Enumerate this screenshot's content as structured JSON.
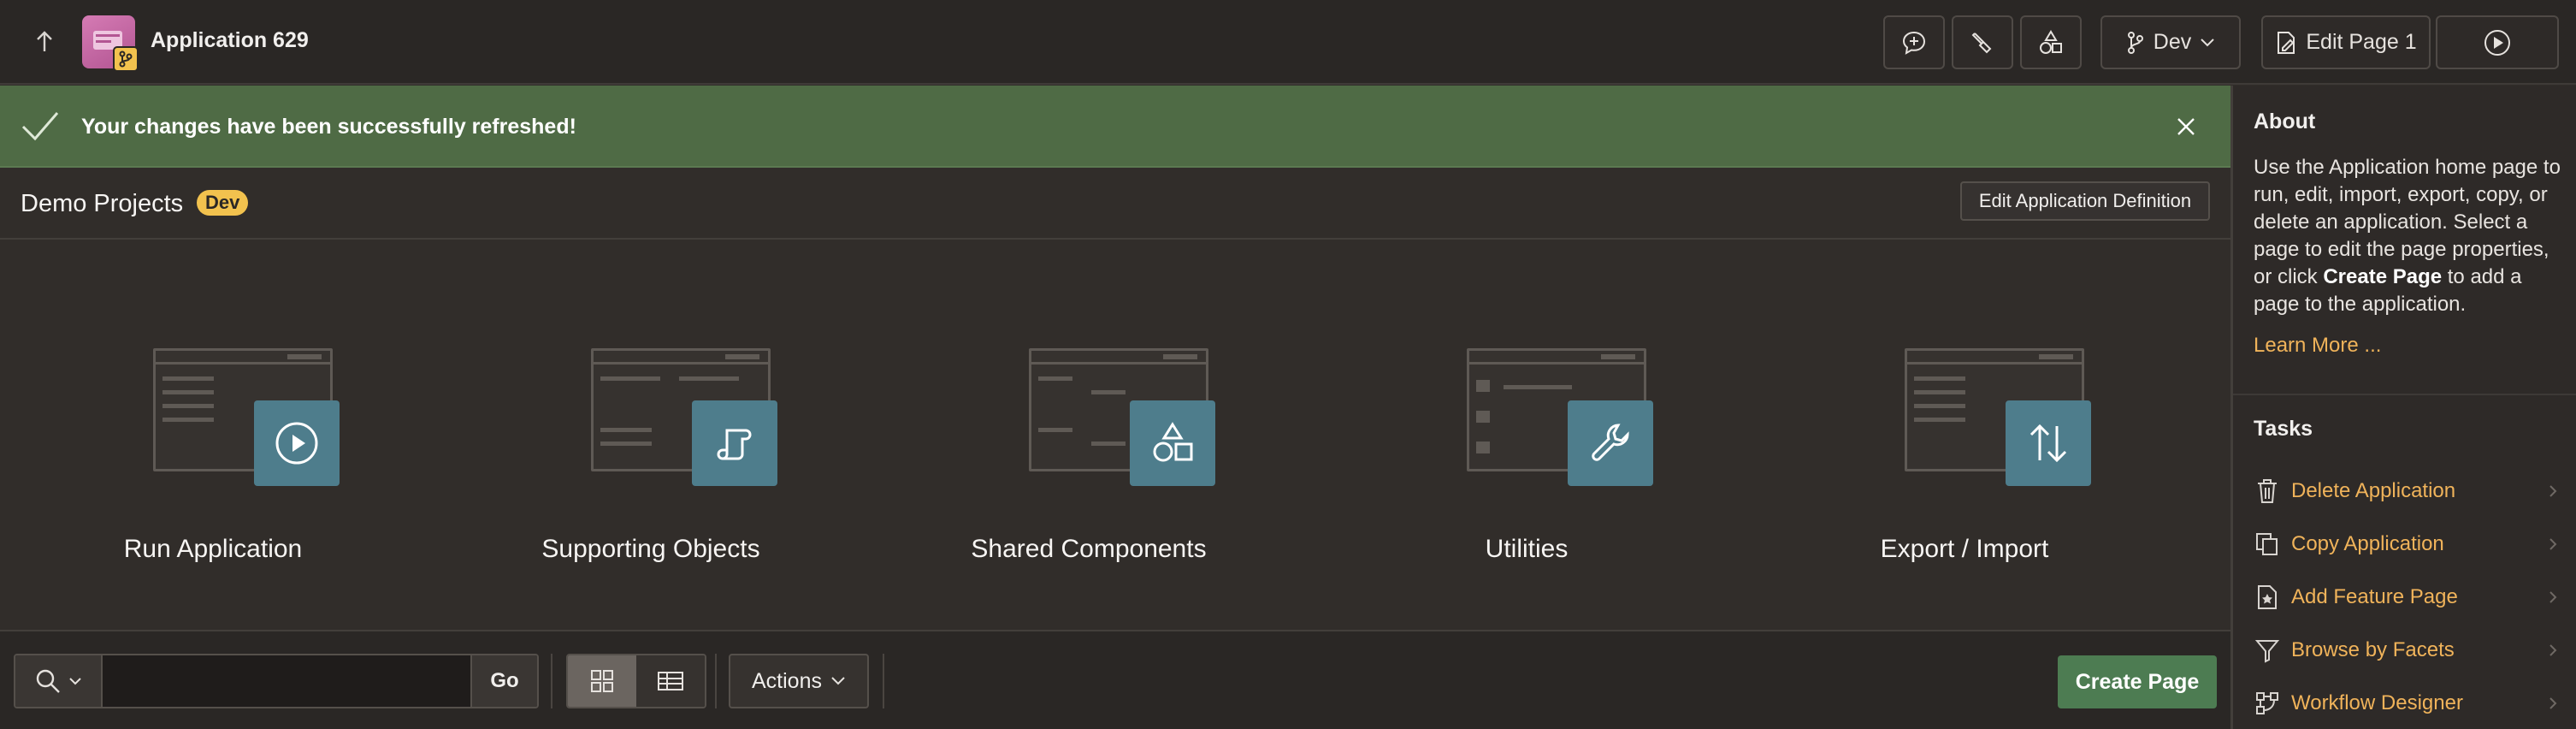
{
  "header": {
    "app_title": "Application 629",
    "branch_label": "Dev",
    "edit_page_label": "Edit Page 1"
  },
  "banner": {
    "message": "Your changes have been successfully refreshed!"
  },
  "region": {
    "title": "Demo Projects",
    "badge": "Dev",
    "edit_definition_label": "Edit Application Definition"
  },
  "tiles": [
    {
      "label": "Run Application",
      "icon": "play-icon"
    },
    {
      "label": "Supporting Objects",
      "icon": "scroll-icon"
    },
    {
      "label": "Shared Components",
      "icon": "shapes-icon"
    },
    {
      "label": "Utilities",
      "icon": "wrench-icon"
    },
    {
      "label": "Export / Import",
      "icon": "arrows-up-down-icon"
    }
  ],
  "toolbar": {
    "search_value": "",
    "go_label": "Go",
    "actions_label": "Actions",
    "create_page_label": "Create Page"
  },
  "sidebar": {
    "about_title": "About",
    "about_text_1": "Use the Application home page to run, edit, import, export, copy, or delete an application. Select a page to edit the page properties, or click",
    "about_bold": "Create Page",
    "about_text_2": "to add a page to the application.",
    "learn_more": "Learn More ...",
    "tasks_title": "Tasks",
    "tasks": [
      {
        "label": "Delete Application",
        "icon": "trash-icon"
      },
      {
        "label": "Copy Application",
        "icon": "copy-icon"
      },
      {
        "label": "Add Feature Page",
        "icon": "add-feature-icon"
      },
      {
        "label": "Browse by Facets",
        "icon": "filter-icon"
      },
      {
        "label": "Workflow Designer",
        "icon": "workflow-icon"
      }
    ]
  },
  "colors": {
    "accent": "#f0b35a",
    "success_banner": "#4f6b45",
    "create_button": "#4d7c52",
    "tile_badge": "#4e7d8c",
    "dev_badge": "#f2c24e"
  }
}
